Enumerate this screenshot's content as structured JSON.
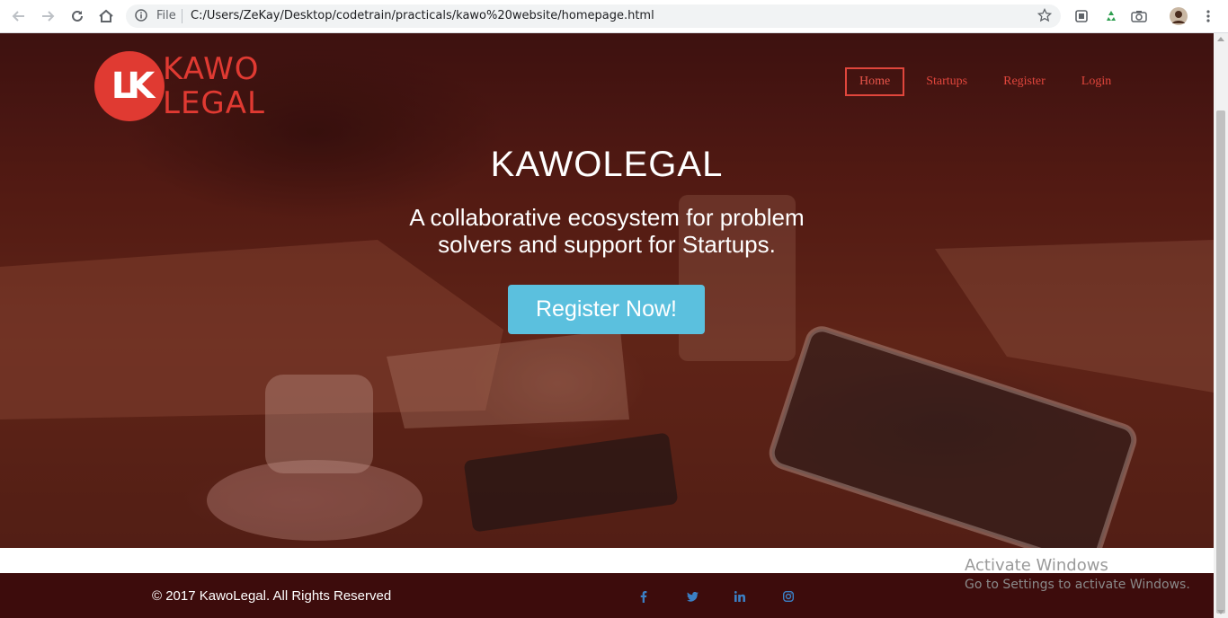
{
  "browser": {
    "file_label": "File",
    "url": "C:/Users/ZeKay/Desktop/codetrain/practicals/kawo%20website/homepage.html",
    "icons": [
      "back-icon",
      "forward-icon",
      "reload-icon",
      "home-icon",
      "info-icon",
      "star-icon",
      "cast-icon",
      "recycle-icon",
      "camera-icon",
      "profile-avatar",
      "menu-dots-icon"
    ]
  },
  "logo": {
    "mark": "LK",
    "word1": "KAWO",
    "word2": "LEGAL",
    "color": "#e03a32"
  },
  "nav": {
    "items": [
      {
        "label": "Home",
        "active": true
      },
      {
        "label": "Startups"
      },
      {
        "label": "Register"
      },
      {
        "label": "Login"
      }
    ]
  },
  "hero": {
    "title": "KAWOLEGAL",
    "subtitle": "A collaborative ecosystem for problem solvers and support for Startups.",
    "cta": "Register Now!",
    "cta_color": "#5bc0de"
  },
  "footer": {
    "copyright": "© 2017 KawoLegal. All Rights Reserved",
    "social": [
      "facebook-icon",
      "twitter-icon",
      "linkedin-icon",
      "instagram-icon"
    ],
    "icon_color": "#3b7fc4",
    "background": "#3d0c0c"
  },
  "watermark": {
    "title": "Activate Windows",
    "subtitle": "Go to Settings to activate Windows."
  }
}
